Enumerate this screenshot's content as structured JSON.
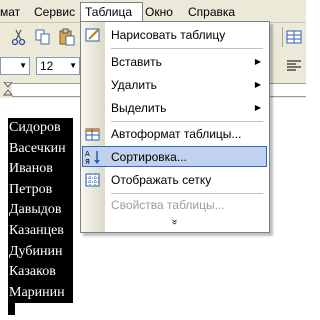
{
  "menubar": {
    "items": [
      "мат",
      "Сервис",
      "Таблица",
      "Окно",
      "Справка"
    ],
    "active_index": 2
  },
  "toolbar": {
    "font_size_value": "12"
  },
  "document": {
    "names": [
      "Сидоров",
      "Васечкин",
      "Иванов",
      "Петров",
      "Давыдов",
      "Казанцев",
      "Дубинин",
      "Казаков",
      "Маринин"
    ]
  },
  "table_menu": {
    "items": [
      {
        "label": "Нарисовать таблицу",
        "icon": "pencil-icon",
        "submenu": false,
        "disabled": false,
        "highlighted": false
      },
      {
        "label": "Вставить",
        "icon": "",
        "submenu": true,
        "disabled": false,
        "highlighted": false
      },
      {
        "label": "Удалить",
        "icon": "",
        "submenu": true,
        "disabled": false,
        "highlighted": false
      },
      {
        "label": "Выделить",
        "icon": "",
        "submenu": true,
        "disabled": false,
        "highlighted": false
      },
      {
        "label": "Автоформат таблицы...",
        "icon": "autoformat-icon",
        "submenu": false,
        "disabled": false,
        "highlighted": false
      },
      {
        "label": "Сортировка...",
        "icon": "sort-az-icon",
        "submenu": false,
        "disabled": false,
        "highlighted": true
      },
      {
        "label": "Отображать сетку",
        "icon": "grid-icon",
        "submenu": false,
        "disabled": false,
        "highlighted": false
      },
      {
        "label": "Свойства таблицы...",
        "icon": "",
        "submenu": false,
        "disabled": true,
        "highlighted": false
      }
    ],
    "more_glyph": "»"
  },
  "colors": {
    "menu_highlight_bg": "#c1d2ee",
    "menu_highlight_border": "#316ac5",
    "toolbar_bg": "#ece9d8",
    "disabled_text": "#9d9d9d"
  }
}
